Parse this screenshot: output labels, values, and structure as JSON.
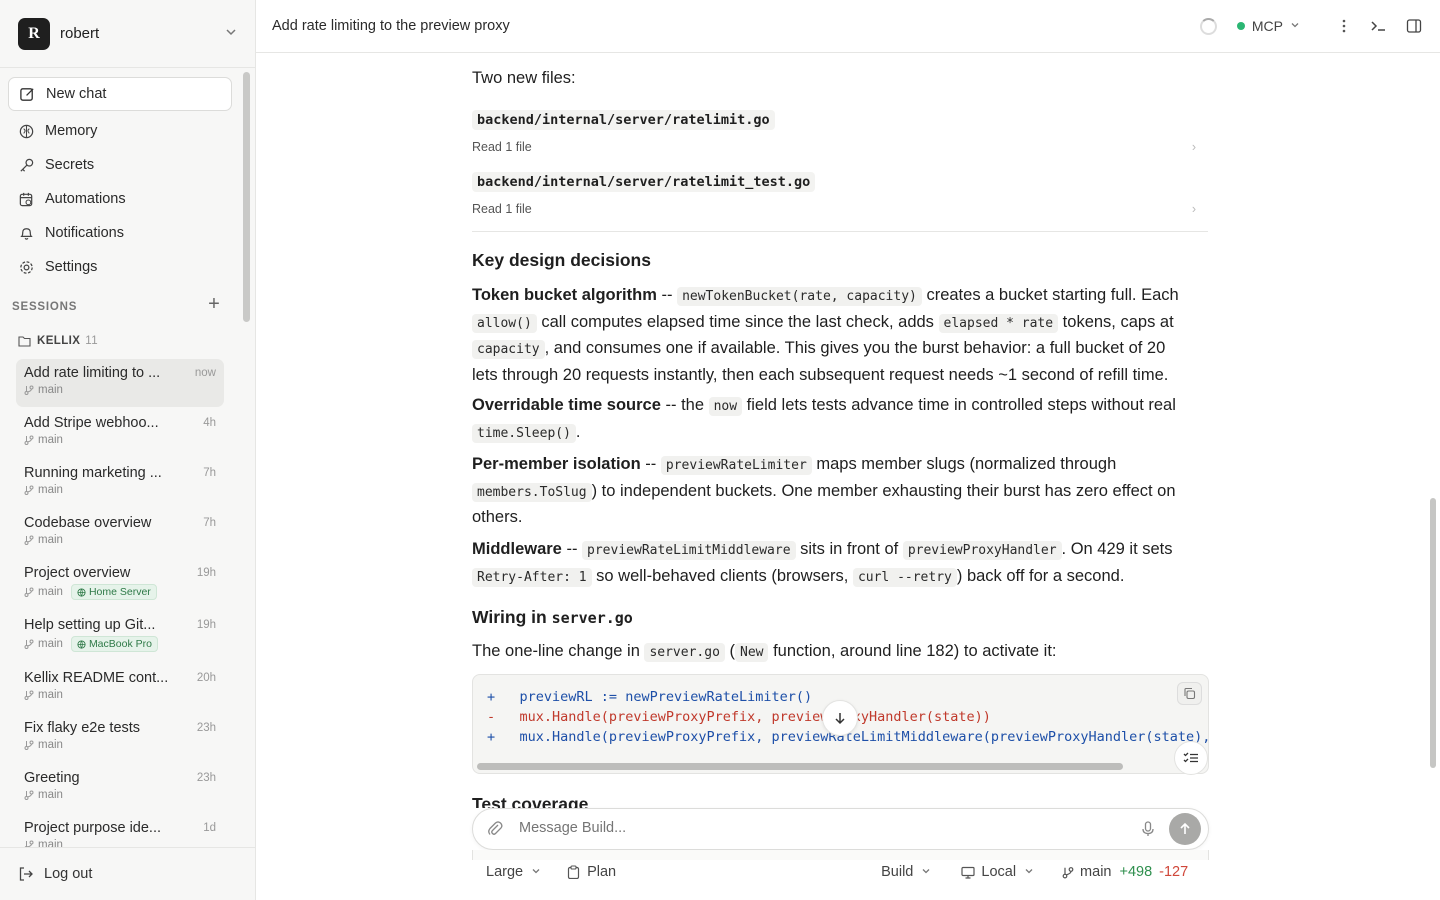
{
  "user": {
    "initial": "R",
    "name": "robert"
  },
  "nav": {
    "new_chat": "New chat",
    "memory": "Memory",
    "secrets": "Secrets",
    "automations": "Automations",
    "notifications": "Notifications",
    "settings": "Settings"
  },
  "sessions": {
    "label": "SESSIONS",
    "group": "KELLIX",
    "group_count": "11",
    "items": [
      {
        "title": "Add rate limiting to ...",
        "time": "now",
        "branch": "main"
      },
      {
        "title": "Add Stripe webhoo...",
        "time": "4h",
        "branch": "main"
      },
      {
        "title": "Running marketing ...",
        "time": "7h",
        "branch": "main"
      },
      {
        "title": "Codebase overview",
        "time": "7h",
        "branch": "main"
      },
      {
        "title": "Project overview",
        "time": "19h",
        "branch": "main",
        "badge": "Home Server"
      },
      {
        "title": "Help setting up Git...",
        "time": "19h",
        "branch": "main",
        "badge": "MacBook Pro"
      },
      {
        "title": "Kellix README cont...",
        "time": "20h",
        "branch": "main"
      },
      {
        "title": "Fix flaky e2e tests",
        "time": "23h",
        "branch": "main"
      },
      {
        "title": "Greeting",
        "time": "23h",
        "branch": "main"
      },
      {
        "title": "Project purpose ide...",
        "time": "1d",
        "branch": "main"
      }
    ]
  },
  "logout": "Log out",
  "topbar": {
    "title": "Add rate limiting to the preview proxy",
    "mcp": "MCP"
  },
  "content": {
    "two_files": "Two new files:",
    "file1": "backend/internal/server/ratelimit.go",
    "file2": "backend/internal/server/ratelimit_test.go",
    "read_label": "Read 1 file",
    "key_heading": "Key design decisions",
    "tb_bold": "Token bucket algorithm",
    "tb_sep": " -- ",
    "tb_code1": "newTokenBucket(rate, capacity)",
    "tb_t1": " creates a bucket starting full. Each",
    "tb_code2": "allow()",
    "tb_t2": " call computes elapsed time since the last check, adds ",
    "tb_code3": "elapsed * rate",
    "tb_t3": " tokens, caps at",
    "tb_code4": "capacity",
    "tb_t4": ", and consumes one if available. This gives you the burst behavior: a full bucket of 20",
    "tb_t5": "lets through 20 requests instantly, then each subsequent request needs ~1 second of refill time.",
    "ot_bold": "Overridable time source",
    "ot_t1": " -- the ",
    "ot_code1": "now",
    "ot_t2": " field lets tests advance time in controlled steps without real",
    "ot_code2": "time.Sleep()",
    "ot_t3": ".",
    "pm_bold": "Per-member isolation",
    "pm_sep": " -- ",
    "pm_code1": "previewRateLimiter",
    "pm_t1": " maps member slugs (normalized through",
    "pm_code2": "members.ToSlug",
    "pm_t2": ") to independent buckets. One member exhausting their burst has zero effect on",
    "pm_t3": "others.",
    "mw_bold": "Middleware",
    "mw_sep": " -- ",
    "mw_code1": "previewRateLimitMiddleware",
    "mw_t1": " sits in front of ",
    "mw_code2": "previewProxyHandler",
    "mw_t2": ". On 429 it sets",
    "mw_code3": "Retry-After: 1",
    "mw_t3": " so well-behaved clients (browsers, ",
    "mw_code4": "curl --retry",
    "mw_t4": ") back off for a second.",
    "wiring_heading": "Wiring in ",
    "wiring_code": "server.go",
    "ol_t1": "The one-line change in ",
    "ol_code1": "server.go",
    "ol_t2": " (",
    "ol_code2": "New",
    "ol_t3": " function, around line 182) to activate it:",
    "code_lines": [
      {
        "sign": "+",
        "text": "previewRL := newPreviewRateLimiter()"
      },
      {
        "sign": "-",
        "text": "mux.Handle(previewProxyPrefix, previewProxyHandler(state))"
      },
      {
        "sign": "+",
        "text": "mux.Handle(previewProxyPrefix, previewRateLimitMiddleware(previewProxyHandler(state), p"
      }
    ],
    "test_heading": "Test coverage"
  },
  "composer": {
    "placeholder": "Message Build..."
  },
  "footer": {
    "size": "Large",
    "plan": "Plan",
    "mode": "Build",
    "env": "Local",
    "branch": "main",
    "added": "+498",
    "removed": "-127"
  },
  "colors": {
    "accent_green": "#2bb673",
    "diff_add": "#2f8f4e",
    "diff_del": "#d0473a"
  }
}
